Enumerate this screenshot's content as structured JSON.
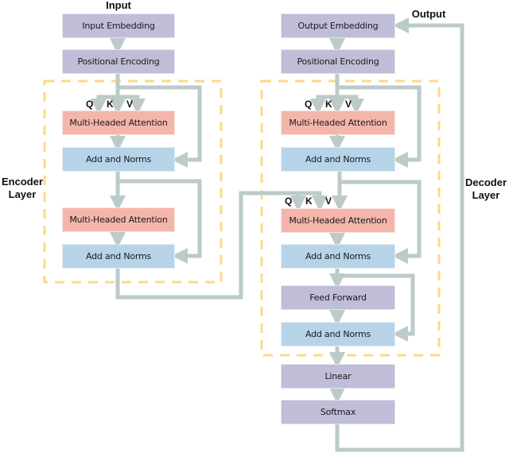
{
  "labels": {
    "input": "Input",
    "output": "Output",
    "encoder_layer": "Encoder\nLayer",
    "decoder_layer": "Decoder\nLayer"
  },
  "encoder": {
    "input_embedding": "Input Embedding",
    "positional_encoding": "Positional Encoding",
    "mha1": "Multi-Headed Attention",
    "add_norm1": "Add and Norms",
    "mha2": "Multi-Headed Attention",
    "add_norm2": "Add and Norms",
    "q": "Q",
    "k": "K",
    "v": "V"
  },
  "decoder": {
    "output_embedding": "Output Embedding",
    "positional_encoding": "Positional Encoding",
    "mha1": "Multi-Headed Attention",
    "add_norm1": "Add and Norms",
    "mha2": "Multi-Headed Attention",
    "add_norm2": "Add and Norms",
    "feed_forward": "Feed Forward",
    "add_norm3": "Add and Norms",
    "linear": "Linear",
    "softmax": "Softmax",
    "q1": "Q",
    "k1": "K",
    "v1": "V",
    "q2": "Q",
    "k2": "K",
    "v2": "V"
  },
  "colors": {
    "embedding": "#bfbdd8",
    "attention": "#f4b6ab",
    "add_norm": "#b7d3e8",
    "connector": "#bccaca",
    "layer_border": "#fed88a"
  }
}
